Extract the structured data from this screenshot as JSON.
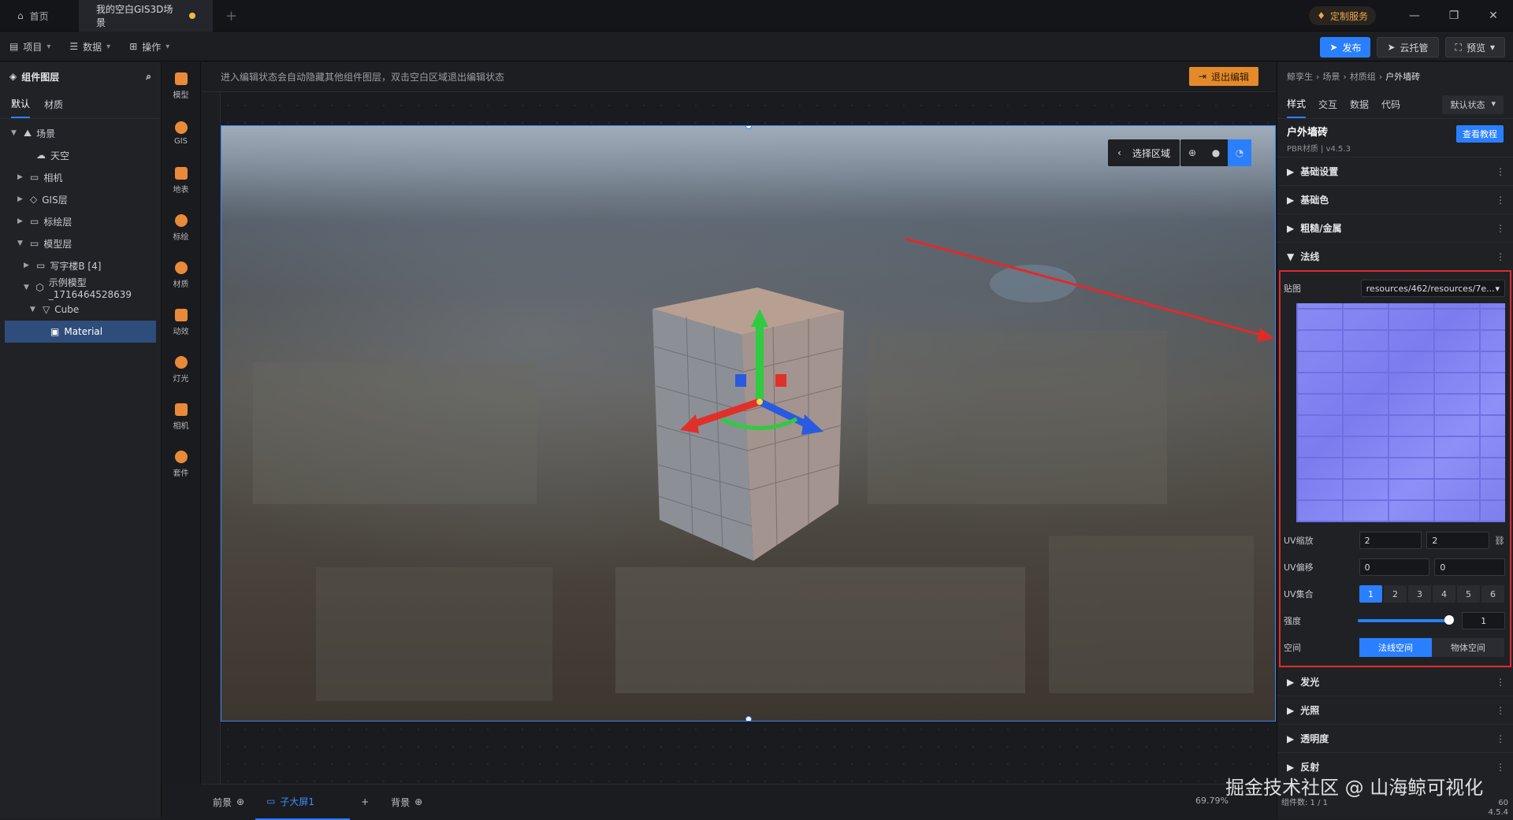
{
  "titlebar": {
    "tabs": [
      {
        "label": "首页"
      },
      {
        "label": "我的空白GIS3D场景"
      }
    ],
    "custom_service": "定制服务"
  },
  "menubar": {
    "menus": [
      {
        "label": "项目"
      },
      {
        "label": "数据"
      },
      {
        "label": "操作"
      }
    ],
    "publish": "发布",
    "cloud": "云托管",
    "preview": "预览"
  },
  "layers": {
    "title": "组件图层",
    "tabs": [
      "默认",
      "材质"
    ],
    "nodes": [
      {
        "label": "场景"
      },
      {
        "label": "天空"
      },
      {
        "label": "相机"
      },
      {
        "label": "GIS层"
      },
      {
        "label": "标绘层"
      },
      {
        "label": "模型层"
      },
      {
        "label": "写字楼B [4]"
      },
      {
        "label": "示例模型_1716464528639"
      },
      {
        "label": "Cube"
      },
      {
        "label": "Material"
      }
    ]
  },
  "tools": [
    {
      "label": "模型"
    },
    {
      "label": "GIS"
    },
    {
      "label": "地表"
    },
    {
      "label": "标绘"
    },
    {
      "label": "材质"
    },
    {
      "label": "动效"
    },
    {
      "label": "灯光"
    },
    {
      "label": "相机"
    },
    {
      "label": "套件"
    }
  ],
  "canvas": {
    "hint": "进入编辑状态会自动隐藏其他组件图层，双击空白区域退出编辑状态",
    "exit_edit": "退出编辑",
    "select_area": "选择区域"
  },
  "bottombar": {
    "foreground": "前景",
    "screen": "子大屏1",
    "background": "背景",
    "zoom": "69.79%"
  },
  "props": {
    "breadcrumb": [
      "鲸孪生",
      "场景",
      "材质组",
      "户外墙砖"
    ],
    "tabs": [
      "样式",
      "交互",
      "数据",
      "代码"
    ],
    "state": "默认状态",
    "material_name": "户外墙砖",
    "material_sub": "PBR材质 | v4.5.3",
    "tutorial": "查看教程",
    "sections_top": [
      "基础设置",
      "基础色",
      "粗糙/金属",
      "法线"
    ],
    "normal": {
      "map_label": "贴图",
      "map_value": "resources/462/resources/7e...",
      "uv_scale_label": "UV缩放",
      "uv_scale": [
        "2",
        "2"
      ],
      "uv_offset_label": "UV偏移",
      "uv_offset": [
        "0",
        "0"
      ],
      "uv_set_label": "UV集合",
      "uv_sets": [
        "1",
        "2",
        "3",
        "4",
        "5",
        "6"
      ],
      "strength_label": "强度",
      "strength": "1",
      "strength_level": 1.0,
      "space_label": "空间",
      "space_options": [
        "法线空间",
        "物体空间"
      ]
    },
    "sections_bottom": [
      "发光",
      "光照",
      "透明度",
      "反射"
    ]
  },
  "status": {
    "components": "组件数: 1 / 1",
    "fps": "60",
    "version": "4.5.4"
  },
  "watermark": "掘金技术社区 @ 山海鲸可视化",
  "colors": {
    "accent": "#2a7fff",
    "highlight": "#e02a2a",
    "exit": "#e58a2a"
  }
}
